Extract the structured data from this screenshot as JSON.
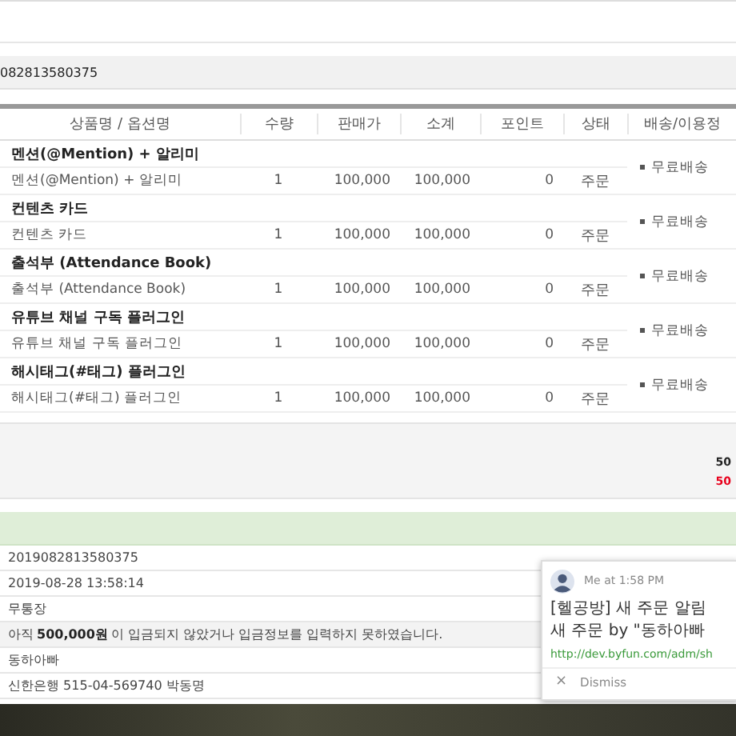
{
  "order_bar": {
    "number": "082813580375"
  },
  "table": {
    "columns": [
      "상품명 / 옵션명",
      "수량",
      "판매가",
      "소계",
      "포인트",
      "상태",
      "배송/이용정"
    ],
    "groups": [
      {
        "title": "멘션(@Mention) + 알리미",
        "option": {
          "name": "멘션(@Mention) + 알리미",
          "qty": "1",
          "price": "100,000",
          "subtotal": "100,000",
          "point": "0",
          "status": "주문"
        },
        "delivery": "무료배송"
      },
      {
        "title": "컨텐츠 카드",
        "option": {
          "name": "컨텐츠 카드",
          "qty": "1",
          "price": "100,000",
          "subtotal": "100,000",
          "point": "0",
          "status": "주문"
        },
        "delivery": "무료배송"
      },
      {
        "title": "출석부 (Attendance Book)",
        "option": {
          "name": "출석부 (Attendance Book)",
          "qty": "1",
          "price": "100,000",
          "subtotal": "100,000",
          "point": "0",
          "status": "주문"
        },
        "delivery": "무료배송"
      },
      {
        "title": "유튜브 채널 구독 플러그인",
        "option": {
          "name": "유튜브 채널 구독 플러그인",
          "qty": "1",
          "price": "100,000",
          "subtotal": "100,000",
          "point": "0",
          "status": "주문"
        },
        "delivery": "무료배송"
      },
      {
        "title": "해시태그(#태그) 플러그인",
        "option": {
          "name": "해시태그(#태그) 플러그인",
          "qty": "1",
          "price": "100,000",
          "subtotal": "100,000",
          "point": "0",
          "status": "주문"
        },
        "delivery": "무료배송"
      }
    ]
  },
  "summary": [
    {
      "text": "50",
      "kind": "total"
    },
    {
      "text": "50",
      "kind": "due"
    }
  ],
  "info_rows": [
    {
      "text": "2019082813580375",
      "highlighted": false
    },
    {
      "text": "2019-08-28 13:58:14",
      "highlighted": false
    },
    {
      "text": "무통장",
      "highlighted": false
    },
    {
      "text": "아직 **500,000원**이 입금되지 않았거나 입금정보를 입력하지 못하였습니다.",
      "highlighted": true
    },
    {
      "text": "동하아빠",
      "highlighted": false
    },
    {
      "text": "신한은행 515-04-569740 박동명",
      "highlighted": false
    }
  ],
  "notification": {
    "sender_time": "Me at 1:58 PM",
    "title": "[헬공방] 새 주문 알림",
    "body": "새 주문 by \"동하아빠",
    "link": "http://dev.byfun.com/adm/sh",
    "dismiss_icon": "×",
    "dismiss": "Dismiss"
  }
}
